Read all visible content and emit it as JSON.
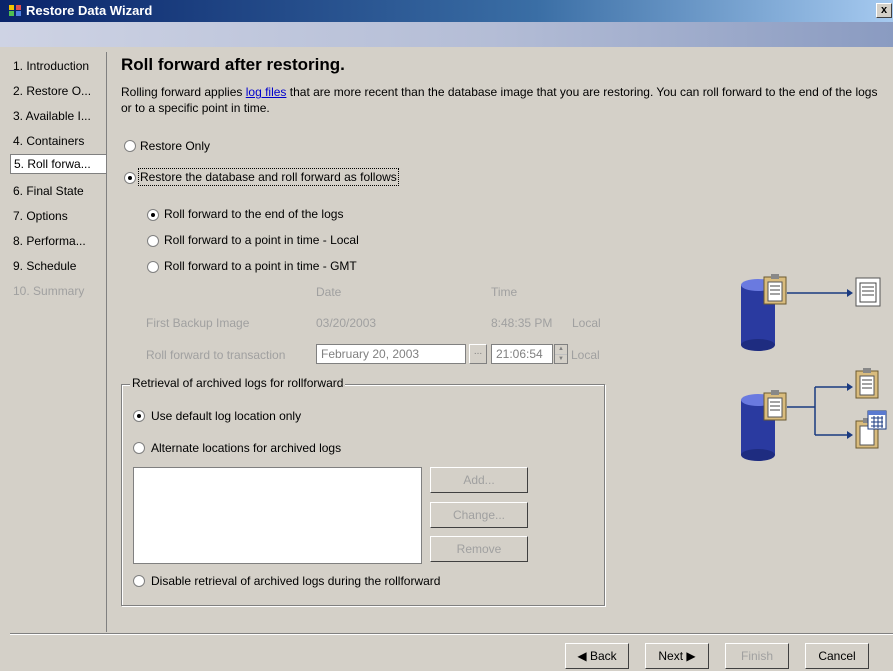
{
  "window": {
    "title": "Restore Data Wizard",
    "close_glyph": "x"
  },
  "sidebar": {
    "items": [
      {
        "label": "1. Introduction"
      },
      {
        "label": "2. Restore O..."
      },
      {
        "label": "3. Available I..."
      },
      {
        "label": "4. Containers"
      },
      {
        "label": "5. Roll forwa..."
      },
      {
        "label": "6. Final State"
      },
      {
        "label": "7. Options"
      },
      {
        "label": "8. Performa..."
      },
      {
        "label": "9. Schedule"
      },
      {
        "label": "10. Summary"
      }
    ]
  },
  "page": {
    "heading": "Roll forward after restoring.",
    "desc_before": "Rolling forward applies ",
    "desc_link": "log files",
    "desc_after": " that are more recent than the database image that you are restoring. You can roll forward to the end of the logs or to a specific point in time."
  },
  "options": {
    "restore_only": "Restore Only",
    "restore_and_roll": "Restore the database and roll forward as follows",
    "roll_end": "Roll forward to the end of the logs",
    "roll_local": "Roll forward to a point in time - Local",
    "roll_gmt": "Roll forward to a point in time - GMT"
  },
  "times": {
    "date_header": "Date",
    "time_header": "Time",
    "first_backup_label": "First Backup Image",
    "first_backup_date": "03/20/2003",
    "first_backup_time": "8:48:35 PM",
    "first_backup_zone": "Local",
    "transaction_label": "Roll forward to transaction",
    "transaction_date": "February 20, 2003",
    "date_button": "...",
    "transaction_time": "21:06:54",
    "transaction_zone": "Local"
  },
  "archive": {
    "legend": "Retrieval of archived logs for rollforward",
    "default_location": "Use default log location only",
    "alternate_locations": "Alternate locations for archived logs",
    "add_button": "Add...",
    "change_button": "Change...",
    "remove_button": "Remove",
    "disable_retrieval": "Disable retrieval of archived logs during the rollforward"
  },
  "buttons": {
    "back": "◀ Back",
    "next": "Next ▶",
    "finish": "Finish",
    "cancel": "Cancel"
  },
  "state": {
    "selected_mode": "restore_and_roll",
    "selected_roll": "roll_end",
    "selected_archive": "default_location",
    "active_step": 5
  },
  "icons": {
    "app": "wizard-app-icon",
    "illustration": [
      "database-cylinder-icon",
      "log-clipboard-icon",
      "log-file-icon",
      "calendar-icon"
    ]
  },
  "colors": {
    "title_bar": "#0a246a",
    "dialog_bg": "#d4d0c8",
    "link": "#0000cc",
    "cylinder": "#2a3aa0",
    "clipboard": "#d9bc7e"
  }
}
